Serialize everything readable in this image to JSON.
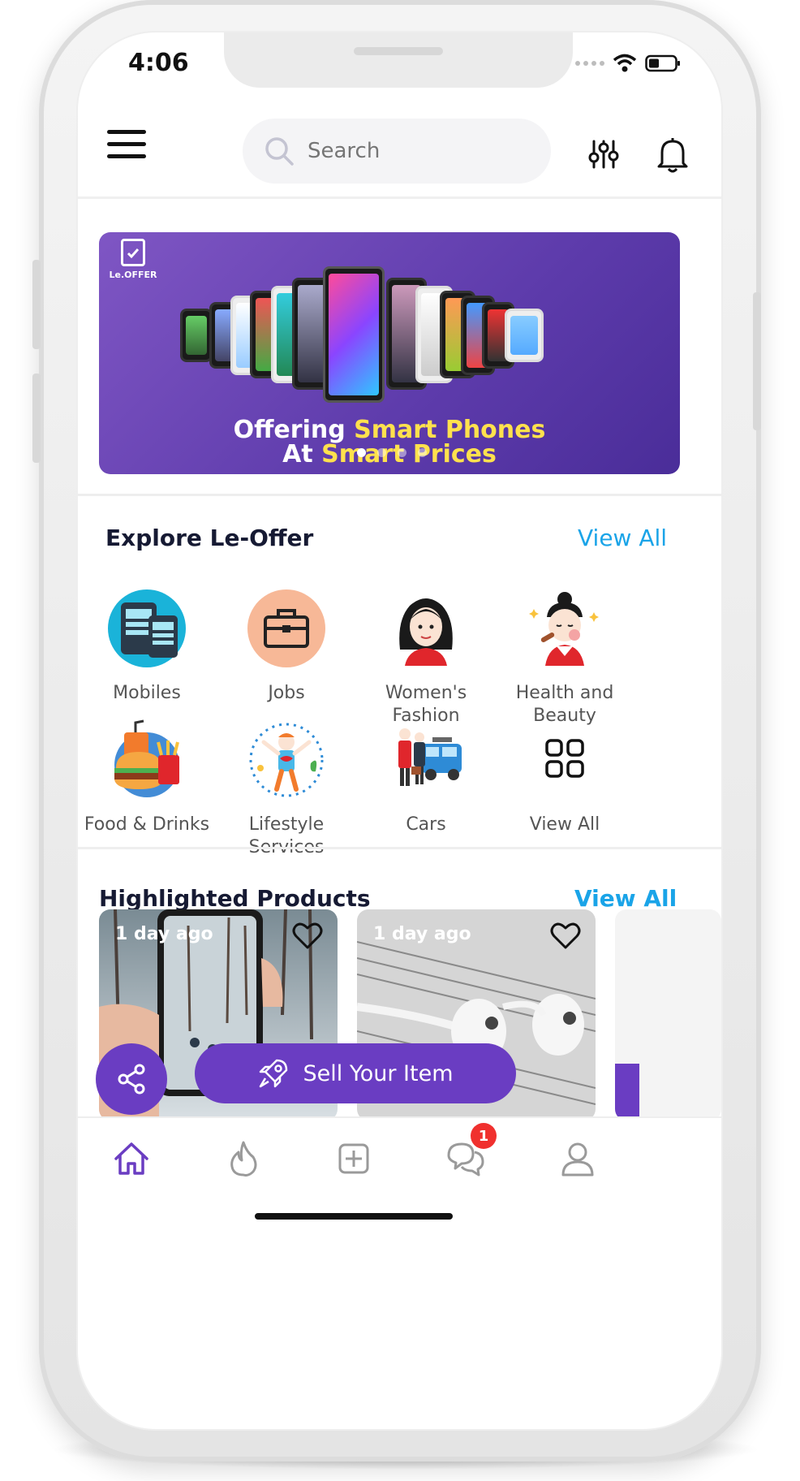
{
  "status_bar": {
    "time": "4:06"
  },
  "header": {
    "search_placeholder": "Search"
  },
  "banner": {
    "logo_text": "Le.OFFER",
    "line1_plain": "Offering ",
    "line1_highlight": "Smart Phones",
    "line2_plain": "At ",
    "line2_highlight": "Smart Prices",
    "dots": 4,
    "active_dot": 1
  },
  "explore": {
    "title": "Explore Le-Offer",
    "view_all": "View All",
    "categories": [
      {
        "label": "Mobiles",
        "icon": "mobiles-icon"
      },
      {
        "label": "Jobs",
        "icon": "briefcase-icon"
      },
      {
        "label": "Women's Fashion",
        "icon": "woman-fashion-icon"
      },
      {
        "label": "Health and Beauty",
        "icon": "health-beauty-icon"
      },
      {
        "label": "Food & Drinks",
        "icon": "food-drinks-icon"
      },
      {
        "label": "Lifestyle Services",
        "icon": "lifestyle-icon"
      },
      {
        "label": "Cars",
        "icon": "cars-icon"
      },
      {
        "label": "View All",
        "icon": "grid-icon"
      }
    ]
  },
  "highlighted": {
    "title": "Highlighted Products",
    "view_all": "View All",
    "products": [
      {
        "time": "1 day ago"
      },
      {
        "time": "1 day ago"
      }
    ]
  },
  "sell_button": {
    "label": "Sell Your Item"
  },
  "tabbar": {
    "chat_badge": "1",
    "active_tab": "home"
  },
  "colors": {
    "accent": "#6a3dc2",
    "link": "#1aa4e8",
    "badge": "#f0302e",
    "title": "#161a33"
  }
}
